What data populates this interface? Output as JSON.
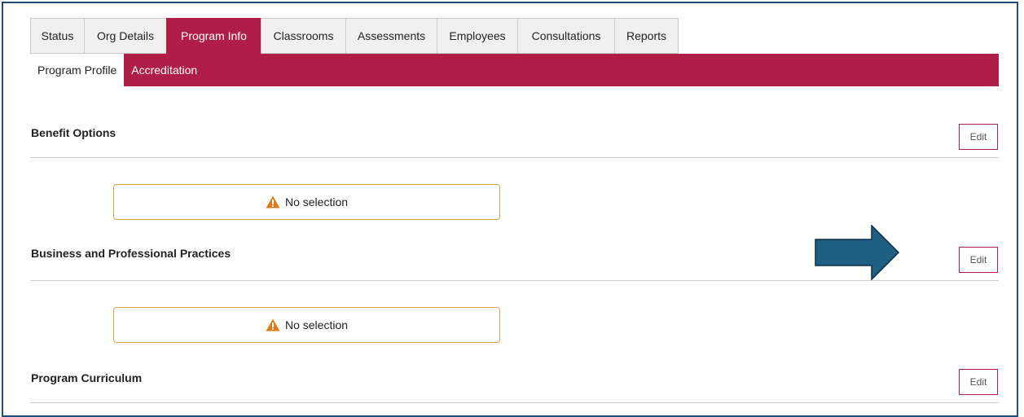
{
  "tabs": [
    {
      "label": "Status",
      "active": false
    },
    {
      "label": "Org Details",
      "active": false
    },
    {
      "label": "Program Info",
      "active": true
    },
    {
      "label": "Classrooms",
      "active": false
    },
    {
      "label": "Assessments",
      "active": false
    },
    {
      "label": "Employees",
      "active": false
    },
    {
      "label": "Consultations",
      "active": false
    },
    {
      "label": "Reports",
      "active": false
    }
  ],
  "subtabs": [
    {
      "label": "Program Profile",
      "active": true
    },
    {
      "label": "Accreditation",
      "active": false
    }
  ],
  "sections": [
    {
      "title": "Benefit Options",
      "edit_label": "Edit",
      "notice": "No selection"
    },
    {
      "title": "Business and Professional Practices",
      "edit_label": "Edit",
      "notice": "No selection"
    },
    {
      "title": "Program Curriculum",
      "edit_label": "Edit"
    }
  ],
  "colors": {
    "accent": "#b01e47",
    "arrow": "#1f5f84",
    "warning": "#e07b1a"
  },
  "icons": {
    "warning": "warning-icon",
    "arrow": "right-arrow-icon"
  }
}
